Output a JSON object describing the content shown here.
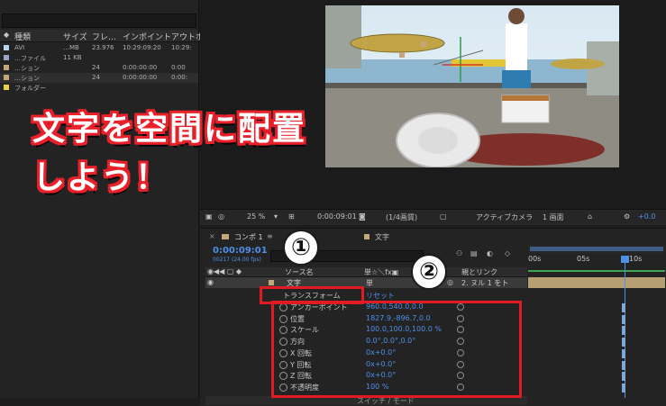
{
  "project": {
    "columns": [
      "種類",
      "サイズ",
      "フレ…",
      "インポイント",
      "アウトポ"
    ],
    "rows": [
      {
        "name": "AVI",
        "size": "…MB",
        "fps": "23.976",
        "in": "10:29:09:20",
        "out": "10:29:",
        "color": "#b8d4e8"
      },
      {
        "name": "…ファイル",
        "size": "11 KB",
        "fps": "",
        "in": "",
        "out": "",
        "color": "#9aa0c8"
      },
      {
        "name": "…ション",
        "size": "",
        "fps": "24",
        "in": "0:00:00:00",
        "out": "0:00",
        "color": "#c2a87a"
      },
      {
        "name": "…ション",
        "size": "",
        "fps": "24",
        "in": "0:00:00:00",
        "out": "0:00:",
        "color": "#c2a87a"
      },
      {
        "name": "フォルダー",
        "size": "",
        "fps": "",
        "in": "",
        "out": "",
        "color": "#e6d24a"
      }
    ]
  },
  "overlay": {
    "line1": "文字を空間に配置",
    "line2": "しよう！",
    "badge1": "①",
    "badge2": "②"
  },
  "viewer_toolbar": {
    "zoom": "25 %",
    "timecode": "0:00:09:01",
    "resolution": "(1/4画質)",
    "camera": "アクティブカメラ",
    "views": "1 画面",
    "offset": "+0.0"
  },
  "timeline": {
    "tabs": [
      "コンポ 1",
      "文字"
    ],
    "current_time": "0:00:09:01",
    "frame_info": "00217 (24.00 fps)",
    "source_header": "ソース名",
    "parent_header": "親とリンク",
    "layer_name": "文字",
    "parent_value": "2. ヌル 1 をト",
    "group_name": "トランスフォーム",
    "reset": "リセット",
    "ruler": [
      "00s",
      "05s",
      "10s"
    ],
    "switches_label": "スイッチ / モード",
    "properties": [
      {
        "name": "アンカーポイント",
        "value": "960.0,540.0,0.0"
      },
      {
        "name": "位置",
        "value": "1827.9,-896.7,0.0"
      },
      {
        "name": "スケール",
        "value": "100.0,100.0,100.0 %"
      },
      {
        "name": "方向",
        "value": "0.0°,0.0°,0.0°"
      },
      {
        "name": "X 回転",
        "value": "0x+0.0°"
      },
      {
        "name": "Y 回転",
        "value": "0x+0.0°"
      },
      {
        "name": "Z 回転",
        "value": "0x+0.0°"
      },
      {
        "name": "不透明度",
        "value": "100 %"
      }
    ]
  }
}
